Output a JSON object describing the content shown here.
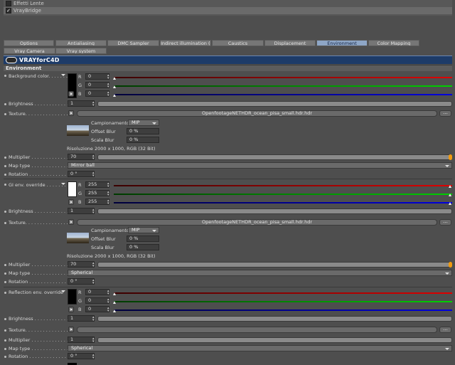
{
  "plugins": [
    "Effetti Lente",
    "VrayBridge"
  ],
  "tabs_row1": [
    "Options",
    "Antialiasing",
    "DMC Sampler",
    "Indirect illumination (GI)",
    "Caustics",
    "Displacement",
    "Environment",
    "Color Mapping"
  ],
  "tabs_row2": [
    "Vray Camera",
    "Vray system"
  ],
  "active_tab": "Environment",
  "brand": "VRAYforC4D",
  "section": "Environment",
  "labels": {
    "background_color": "Background color. . . . . . .",
    "gi_override": "GI env. override . . . . . . .",
    "reflection_override": "Reflection env. override",
    "brightness": "Brightness . . . . . . . . . . . .",
    "texture": "Texture. . . . . . . . . . . . . . .",
    "multiplier": "Multiplier . . . . . . . . . . . . .",
    "map_type": "Map type . . . . . . . . . . . . .",
    "rotation": "Rotation . . . . . . . . . . . . . ."
  },
  "rgb_letters": [
    "R",
    "G",
    "B"
  ],
  "background": {
    "r": "0",
    "g": "0",
    "b": "0",
    "brightness": "1",
    "texture": "OpenfootageNETHDR_ocean_pisa_small.hdr.hdr",
    "sampling_label": "Campionamento",
    "sampling": "MIP",
    "offset_label": "Offset Blur",
    "offset": "0 %",
    "scale_label": "Scala Blur",
    "scale": "0 %",
    "resolution": "Risoluzione 2000 x 1000, RGB (32 Bit)",
    "multiplier": "70",
    "map_type": "Mirror ball",
    "rotation": "0 °"
  },
  "gi": {
    "r": "255",
    "g": "255",
    "b": "255",
    "brightness": "1",
    "texture": "OpenfootageNETHDR_ocean_pisa_small.hdr.hdr",
    "sampling_label": "Campionamento",
    "sampling": "MIP",
    "offset_label": "Offset Blur",
    "offset": "0 %",
    "scale_label": "Scala Blur",
    "scale": "0 %",
    "resolution": "Risoluzione 2000 x 1000, RGB (32 Bit)",
    "multiplier": "70",
    "map_type": "Spherical",
    "rotation": "0 °"
  },
  "reflection": {
    "r": "0",
    "g": "0",
    "b": "0",
    "brightness": "1",
    "multiplier": "1",
    "map_type": "Spherical",
    "rotation": "0 °"
  },
  "browse_label": "...",
  "colors": {
    "accent": "#8ea6c6",
    "banner": "#1d3b68",
    "orange": "#f09a10"
  }
}
